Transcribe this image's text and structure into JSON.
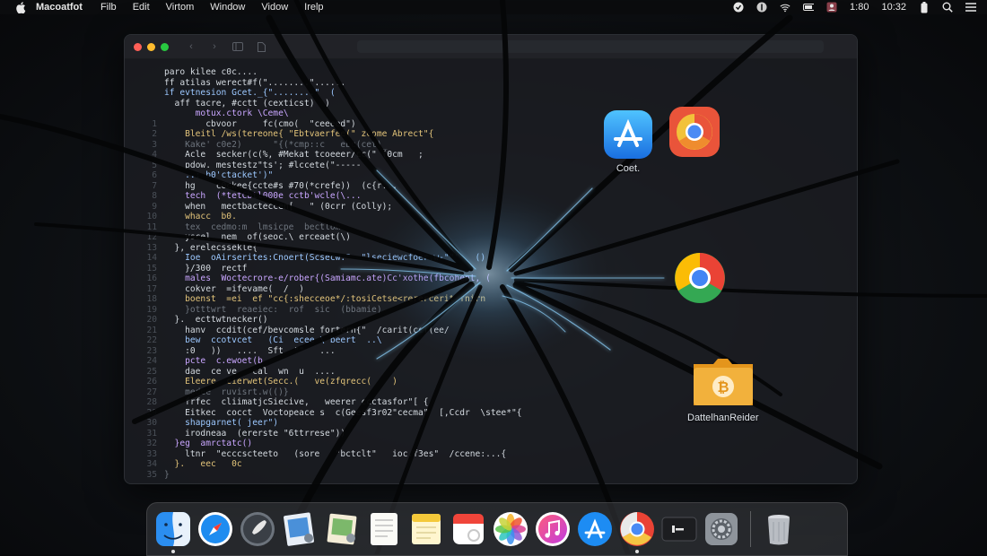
{
  "menubar": {
    "apple_icon": "apple-icon",
    "app_name": "Macoatfot",
    "items": [
      "Filb",
      "Edit",
      "Virtom",
      "Window",
      "Vidow",
      "Irelp"
    ],
    "status": {
      "time_left": "1:80",
      "time_right": "10:32"
    }
  },
  "editor": {
    "lines": [
      [
        "",
        "paro kilee c0c...."
      ],
      [
        "",
        "ff atilas werect#f(\"........\"......"
      ],
      [
        "",
        "if evtnesion Gcet._{\"........\"  ("
      ],
      [
        "",
        "  aff tacre, #cctt (cexticst)  )"
      ],
      [
        "",
        "      motux.ctork \\Ceme\\"
      ],
      [
        "1",
        "        cbvoor     fc(cmo(  \"ceeeed\")"
      ],
      [
        "2",
        "    Bleitl /ws(tereone{ \"Ebtvaerfee(\" zcome Abrect\"{"
      ],
      [
        "3",
        "    Kake' c0e2)      \"{(*cmp::c   ebc(cet)_"
      ],
      [
        "4",
        "    Acle  secker(c(%, #Mekat tcoeeer/cc(\" (0cm   ;"
      ],
      [
        "5",
        "    pdow. mestestz\"ts'; #lccete(\"-----"
      ],
      [
        "6",
        "    ..: b0'ctacket')\""
      ],
      [
        "7",
        "    hg    c0ckee{ccte#s #70(*crefe))  (c{r..."
      ],
      [
        "8",
        "    tech  (*tetCbtl000e cctb'wcle(\\..."
      ],
      [
        "9",
        "    when   mectbacteccen[   \" (0crr (Colly);"
      ],
      [
        "10",
        "    whacc  b0."
      ],
      [
        "11",
        "    tex  cedmo:m  lmsicpe  bectlom"
      ],
      [
        "12",
        "    yscel  nem  of(seoc.\\ erceaet(\\)"
      ],
      [
        "13",
        "  }, erelecssekle{"
      ],
      [
        "14",
        "    Ioe  oAirserites:Cnoert(Scsecw.\"  \"lseciewcfoer.w-\"\"\"   ()"
      ],
      [
        "15",
        "    }/300  rectf"
      ],
      [
        "16",
        "    males  Woctecrore-e/rober{(Samiamc.ate)Cc'xothe(fbcohent, ("
      ],
      [
        "17",
        "    cokver  =ifevame(  /  )"
      ],
      [
        "18",
        "    boenst  =ei  ef \"cc{:shecceoe*/:tosiCetse<rerercerit fnirn"
      ],
      [
        "19",
        "    }otttwrt  reaeiec:  rof  sic  (bbamie)"
      ],
      [
        "20",
        "  }.  ecttwtnecker()"
      ],
      [
        "21",
        "    hanv  ccdit(cef/bevcomsle fortern{\"  /carit(ccf(ee/"
      ],
      [
        "22",
        "    bew  ccotvcet   (Ci  ecee \\ beert  ..\\"
      ],
      [
        "23",
        "    :0   ))   ....  Sft  \"\"   ..."
      ],
      [
        "24",
        "    pcte  c.ewoet(b"
      ],
      [
        "25",
        "    dae  ce ve   cal  wn  u  ...."
      ],
      [
        "26",
        "    Eleere  cierwet(Secc.(   ve(zfqrecc(    )"
      ],
      [
        "27",
        "    medee  ruvisrt.w(()}"
      ],
      [
        "28",
        "    frfec  cliimatjcSiecive,   weerer ccctasfor\"[ {"
      ],
      [
        "29",
        "    Eitkec  cocct  Voctopeace s  c(Geesf3r02\"cecma\"  [,Ccdr  \\stee*\"{"
      ],
      [
        "30",
        "    shapgarnet( jeer\")"
      ],
      [
        "31",
        "    irodneaa  (ererste \"6ttrrese\"))"
      ],
      [
        "32",
        "  }eg  amrctatc()"
      ],
      [
        "33",
        "    ltnr  \"ecccscteeto   (sore   \"bctclt\"   ioc.f3es\"  /ccene:...{"
      ],
      [
        "34",
        "  }.   eec   0c"
      ],
      [
        "35",
        "}"
      ]
    ]
  },
  "desktop_icons": [
    {
      "icon": "app-store-icon",
      "label": "Coet."
    },
    {
      "icon": "chrome-icon",
      "label": ""
    },
    {
      "icon": "chrome-icon",
      "label": ""
    },
    {
      "icon": "bitcoin-folder-icon",
      "label": "DattelhanReider"
    }
  ],
  "dock": {
    "items": [
      {
        "icon": "finder-icon",
        "running": true
      },
      {
        "icon": "safari-icon",
        "running": false
      },
      {
        "icon": "launchpad-icon",
        "running": false
      },
      {
        "icon": "preview-icon",
        "running": false
      },
      {
        "icon": "image-capture-icon",
        "running": false
      },
      {
        "icon": "notes-icon",
        "running": false
      },
      {
        "icon": "stickies-icon",
        "running": false
      },
      {
        "icon": "calendar-icon",
        "running": false
      },
      {
        "icon": "photos-icon",
        "running": false
      },
      {
        "icon": "music-icon",
        "running": false
      },
      {
        "icon": "app-store-icon",
        "running": false
      },
      {
        "icon": "chrome-icon",
        "running": true
      },
      {
        "icon": "terminal-icon",
        "running": false
      },
      {
        "icon": "system-preferences-icon",
        "running": false
      },
      {
        "icon": "trash-icon",
        "running": false
      }
    ]
  },
  "colors": {
    "accent_glow": "#8fd4ff",
    "menubar_bg": "#0b0c0e",
    "folder_orange": "#f0a629"
  }
}
